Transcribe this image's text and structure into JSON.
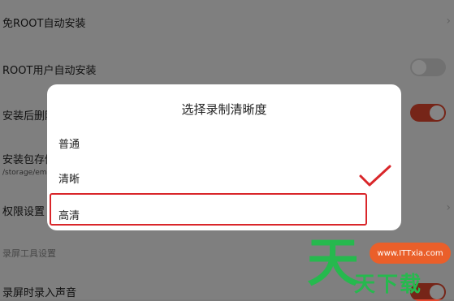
{
  "settings": {
    "row1": {
      "title": "免ROOT自动安装"
    },
    "row2": {
      "title": "ROOT用户自动安装",
      "toggle": "off"
    },
    "row3": {
      "title": "安装后删除",
      "toggle": "on"
    },
    "row4": {
      "title": "安装包存储",
      "subtitle": "/storage/em"
    },
    "row5": {
      "title": "权限设置"
    },
    "section": "录屏工具设置",
    "row6": {
      "title": "录屏时录入声音",
      "toggle": "on"
    }
  },
  "dialog": {
    "title": "选择录制清晰度",
    "options": [
      {
        "label": "普通"
      },
      {
        "label": "清晰",
        "selected": true
      },
      {
        "label": "高清",
        "highlighted": true
      }
    ]
  },
  "watermark": {
    "url": "www.ITTxia.com",
    "big": "天",
    "small": "天下载"
  },
  "colors": {
    "accent": "#e2482f",
    "highlight_border": "#d9262a",
    "watermark_green": "#26b94e",
    "watermark_orange": "#ea5f2a"
  }
}
